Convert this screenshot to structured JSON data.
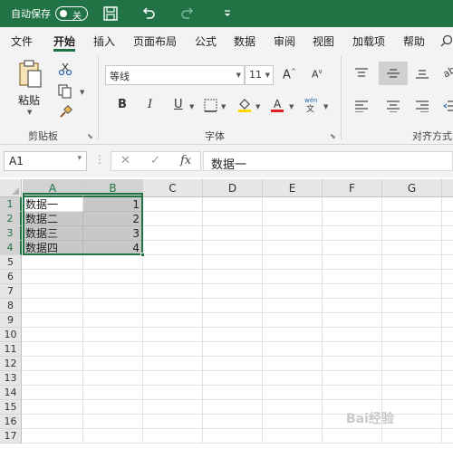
{
  "titlebar": {
    "autosave_label": "自动保存",
    "toggle_state": "关",
    "icons": [
      "save-icon",
      "undo-icon",
      "redo-icon",
      "customize-quick-access-icon"
    ],
    "accent": "#217346"
  },
  "tabs": [
    {
      "label": "文件",
      "active": false
    },
    {
      "label": "开始",
      "active": true
    },
    {
      "label": "插入",
      "active": false
    },
    {
      "label": "页面布局",
      "active": false
    },
    {
      "label": "公式",
      "active": false
    },
    {
      "label": "数据",
      "active": false
    },
    {
      "label": "审阅",
      "active": false
    },
    {
      "label": "视图",
      "active": false
    },
    {
      "label": "加载项",
      "active": false
    },
    {
      "label": "帮助",
      "active": false
    }
  ],
  "ribbon": {
    "clipboard": {
      "group_label": "剪贴板",
      "paste_label": "粘贴"
    },
    "font": {
      "group_label": "字体",
      "font_name": "等线",
      "font_size": "11"
    },
    "alignment": {
      "group_label": "对齐方式"
    }
  },
  "formula_bar": {
    "name_box": "A1",
    "content": "数据一"
  },
  "grid": {
    "columns": [
      "A",
      "B",
      "C",
      "D",
      "E",
      "F",
      "G"
    ],
    "selected_columns": [
      "A",
      "B"
    ],
    "rows": [
      "1",
      "2",
      "3",
      "4",
      "5",
      "6",
      "7",
      "8",
      "9",
      "10",
      "11",
      "12",
      "13",
      "14",
      "15",
      "16",
      "17"
    ],
    "selected_rows": [
      "1",
      "2",
      "3",
      "4"
    ],
    "data": [
      {
        "a": "数据一",
        "b": "1"
      },
      {
        "a": "数据二",
        "b": "2"
      },
      {
        "a": "数据三",
        "b": "3"
      },
      {
        "a": "数据四",
        "b": "4"
      }
    ]
  },
  "watermark": "Bai经验"
}
